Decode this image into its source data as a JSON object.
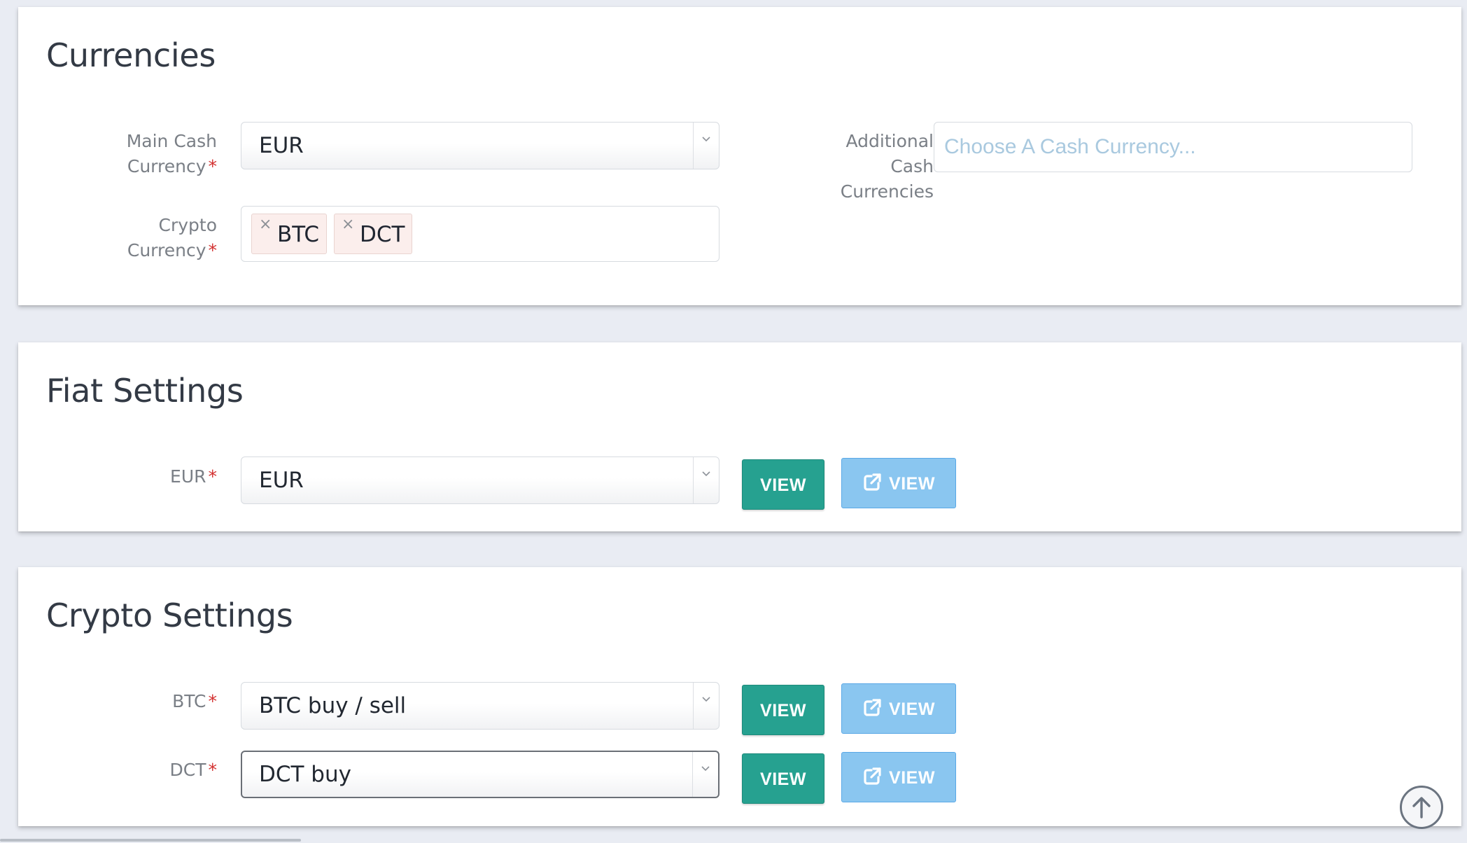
{
  "currencies": {
    "title": "Currencies",
    "main_cash": {
      "label": "Main Cash\nCurrency",
      "required_mark": "*",
      "value": "EUR"
    },
    "crypto": {
      "label": "Crypto\nCurrency",
      "required_mark": "*",
      "tags": [
        "BTC",
        "DCT"
      ],
      "remove_glyph": "×"
    },
    "additional": {
      "label": "Additional\nCash\nCurrencies",
      "placeholder": "Choose A Cash Currency..."
    }
  },
  "fiat": {
    "title": "Fiat Settings",
    "rows": [
      {
        "label": "EUR",
        "required_mark": "*",
        "value": "EUR",
        "view_label": "VIEW",
        "view_external_label": "VIEW"
      }
    ]
  },
  "crypto_settings": {
    "title": "Crypto Settings",
    "rows": [
      {
        "label": "BTC",
        "required_mark": "*",
        "value": "BTC buy / sell",
        "view_label": "VIEW",
        "view_external_label": "VIEW"
      },
      {
        "label": "DCT",
        "required_mark": "*",
        "value": "DCT buy",
        "view_label": "VIEW",
        "view_external_label": "VIEW"
      }
    ]
  },
  "icons": {
    "dropdown": "chevron-down-icon",
    "external": "external-link-icon",
    "scroll_top": "arrow-up-circle-icon",
    "tag_remove": "close-icon"
  },
  "colors": {
    "background": "#e9ecf3",
    "required": "#d3302f",
    "view_button": "#26a190",
    "view_external_button": "#8ac6f0",
    "placeholder": "#a9c9df"
  }
}
